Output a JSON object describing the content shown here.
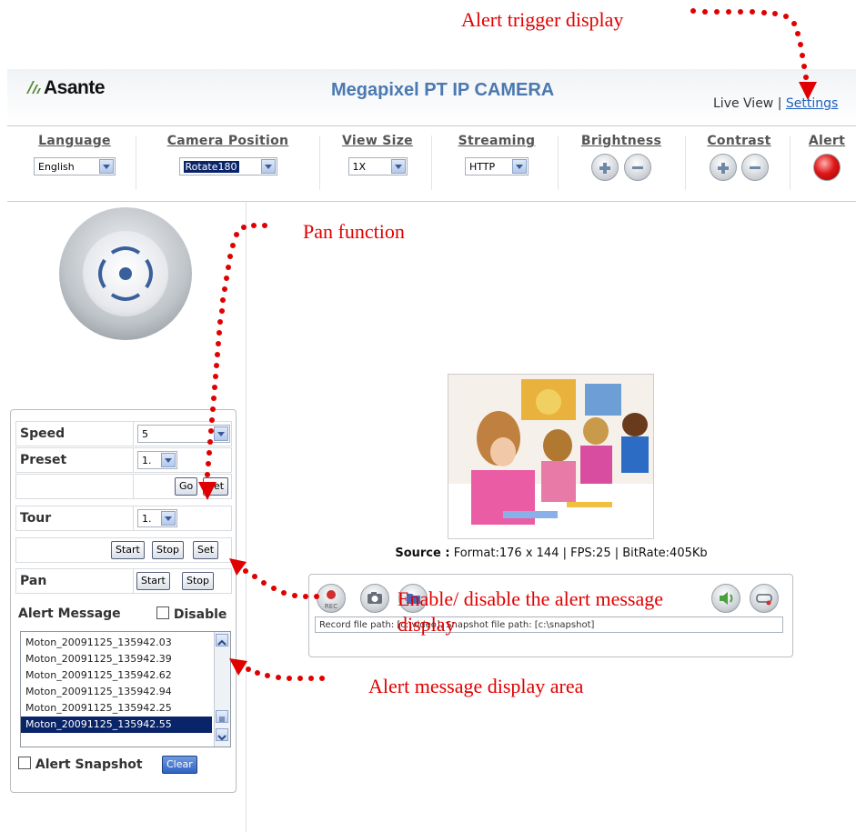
{
  "annotations": {
    "alert_trigger": "Alert trigger display",
    "pan_function": "Pan function",
    "enable_disable": "Enable/ disable the alert message display",
    "alert_area": "Alert message display area"
  },
  "header": {
    "brand": "Asante",
    "product": "Megapixel PT IP CAMERA",
    "live_view": "Live View",
    "separator": "|",
    "settings_link": "Settings"
  },
  "toolbar": {
    "language": {
      "label": "Language",
      "value": "English"
    },
    "camera_position": {
      "label": "Camera Position",
      "value": "Rotate180"
    },
    "view_size": {
      "label": "View Size",
      "value": "1X"
    },
    "streaming": {
      "label": "Streaming",
      "value": "HTTP"
    },
    "brightness": {
      "label": "Brightness"
    },
    "contrast": {
      "label": "Contrast"
    },
    "alert": {
      "label": "Alert",
      "color": "#e01818"
    }
  },
  "ptz": {
    "speed": {
      "label": "Speed",
      "value": "5"
    },
    "preset": {
      "label": "Preset",
      "value": "1.",
      "go": "Go",
      "set": "Set"
    },
    "tour": {
      "label": "Tour",
      "value": "1.",
      "start": "Start",
      "stop": "Stop",
      "set": "Set"
    },
    "pan": {
      "label": "Pan",
      "start": "Start",
      "stop": "Stop"
    }
  },
  "alert_message": {
    "label": "Alert Message",
    "disable": "Disable",
    "items": [
      "Moton_20091125_135942.03",
      "Moton_20091125_135942.39",
      "Moton_20091125_135942.62",
      "Moton_20091125_135942.94",
      "Moton_20091125_135942.25",
      "Moton_20091125_135942.55"
    ],
    "selected_index": 5,
    "snapshot_label": "Alert Snapshot",
    "clear": "Clear"
  },
  "video": {
    "source_label": "Source :",
    "source_info": "Format:176 x 144 | FPS:25 | BitRate:405Kb",
    "rec_label": "REC",
    "path_text": "Record file path: [c:\\video], Snapshot file path: [c:\\snapshot]"
  }
}
